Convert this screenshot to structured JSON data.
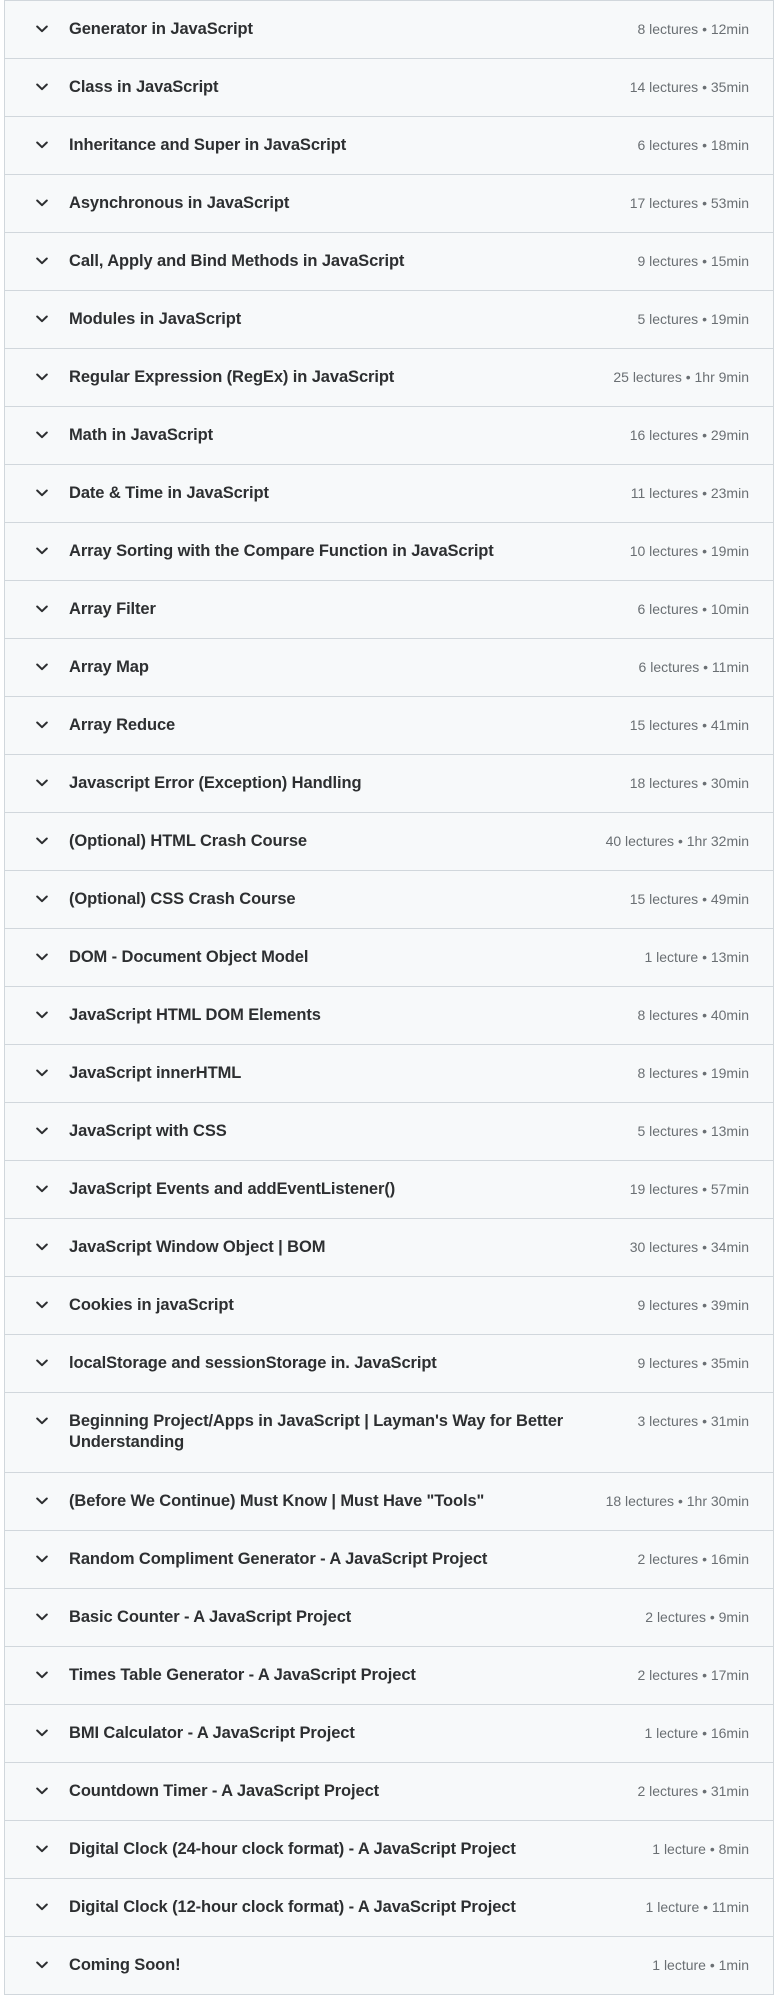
{
  "curriculum": {
    "icon": "chevron-down-icon",
    "sections": [
      {
        "title": "Generator in JavaScript",
        "meta": "8 lectures • 12min"
      },
      {
        "title": "Class in JavaScript",
        "meta": "14 lectures • 35min"
      },
      {
        "title": "Inheritance and Super in JavaScript",
        "meta": "6 lectures • 18min"
      },
      {
        "title": "Asynchronous in JavaScript",
        "meta": "17 lectures • 53min"
      },
      {
        "title": "Call, Apply and Bind Methods in JavaScript",
        "meta": "9 lectures • 15min"
      },
      {
        "title": "Modules in JavaScript",
        "meta": "5 lectures • 19min"
      },
      {
        "title": "Regular Expression (RegEx) in JavaScript",
        "meta": "25 lectures • 1hr 9min"
      },
      {
        "title": "Math in JavaScript",
        "meta": "16 lectures • 29min"
      },
      {
        "title": "Date & Time in JavaScript",
        "meta": "11 lectures • 23min"
      },
      {
        "title": "Array Sorting with the Compare Function in JavaScript",
        "meta": "10 lectures • 19min"
      },
      {
        "title": "Array Filter",
        "meta": "6 lectures • 10min"
      },
      {
        "title": "Array Map",
        "meta": "6 lectures • 11min"
      },
      {
        "title": "Array Reduce",
        "meta": "15 lectures • 41min"
      },
      {
        "title": "Javascript Error (Exception) Handling",
        "meta": "18 lectures • 30min"
      },
      {
        "title": "(Optional) HTML Crash Course",
        "meta": "40 lectures • 1hr 32min"
      },
      {
        "title": "(Optional) CSS Crash Course",
        "meta": "15 lectures • 49min"
      },
      {
        "title": "DOM - Document Object Model",
        "meta": "1 lecture • 13min"
      },
      {
        "title": "JavaScript HTML DOM Elements",
        "meta": "8 lectures • 40min"
      },
      {
        "title": "JavaScript innerHTML",
        "meta": "8 lectures • 19min"
      },
      {
        "title": "JavaScript with CSS",
        "meta": "5 lectures • 13min"
      },
      {
        "title": "JavaScript Events and addEventListener()",
        "meta": "19 lectures • 57min"
      },
      {
        "title": "JavaScript Window Object | BOM",
        "meta": "30 lectures • 34min"
      },
      {
        "title": "Cookies in javaScript",
        "meta": "9 lectures • 39min"
      },
      {
        "title": "localStorage and sessionStorage in. JavaScript",
        "meta": "9 lectures • 35min"
      },
      {
        "title": "Beginning Project/Apps in JavaScript | Layman's Way for Better Understanding",
        "meta": "3 lectures • 31min"
      },
      {
        "title": "(Before We Continue) Must Know | Must Have \"Tools\"",
        "meta": "18 lectures • 1hr 30min"
      },
      {
        "title": "Random Compliment Generator - A JavaScript Project",
        "meta": "2 lectures • 16min"
      },
      {
        "title": "Basic Counter - A JavaScript Project",
        "meta": "2 lectures • 9min"
      },
      {
        "title": "Times Table Generator - A JavaScript Project",
        "meta": "2 lectures • 17min"
      },
      {
        "title": "BMI Calculator - A JavaScript Project",
        "meta": "1 lecture • 16min"
      },
      {
        "title": "Countdown Timer - A JavaScript Project",
        "meta": "2 lectures • 31min"
      },
      {
        "title": "Digital Clock (24-hour clock format) - A JavaScript Project",
        "meta": "1 lecture • 8min"
      },
      {
        "title": "Digital Clock (12-hour clock format) - A JavaScript Project",
        "meta": "1 lecture • 11min"
      },
      {
        "title": "Coming Soon!",
        "meta": "1 lecture • 1min"
      }
    ]
  }
}
